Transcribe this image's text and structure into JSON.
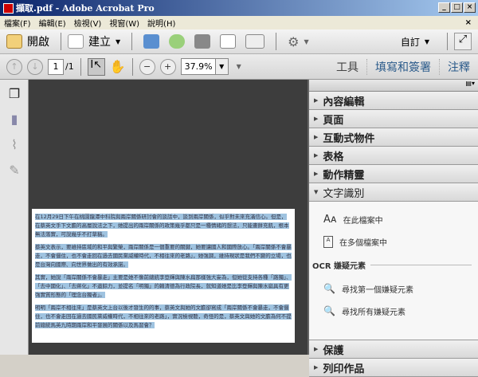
{
  "window": {
    "title": "擷取.pdf - Adobe Acrobat Pro",
    "min": "_",
    "max": "□",
    "close": "×"
  },
  "menu": [
    "檔案(F)",
    "編輯(E)",
    "檢視(V)",
    "視窗(W)",
    "說明(H)"
  ],
  "menu_close": "×",
  "toolbar": {
    "open": "開啟",
    "create": "建立",
    "customize": "自訂"
  },
  "nav": {
    "page": "1",
    "total": "/1",
    "zoom": "37.9%"
  },
  "pane_tabs": [
    "工具",
    "填寫和簽署",
    "注釋"
  ],
  "panel": {
    "sections_top": [
      "內容編輯",
      "頁面",
      "互動式物件",
      "表格",
      "動作精靈"
    ],
    "open_section": "文字識別",
    "items": [
      "在此檔案中",
      "在多個檔案中"
    ],
    "ocr_heading": "OCR 嫌疑元素",
    "ocr_items": [
      "尋找第一個嫌疑元素",
      "尋找所有嫌疑元素"
    ],
    "sections_bottom": [
      "保護",
      "列印作品"
    ]
  },
  "document": {
    "paragraphs": [
      "在12月29日下午在桃園龍潭中科院與兩岸關係研討會的談話中，談到兩岸關係，似乎對未來充滿信心。但是，在蔡英文手下文膽的高層說法之下，她提出的兩岸關係的政策幾乎都只是一種情緒的想法，只能畫餅充飢，根本無法落實，可說幾乎不打草稿。",
      "蔡英文表示，要維持區域的和平與繁榮，兩岸關係是一個重要的關鍵，她要讓國人和國際放心。「兩岸關係不會暴走，不會僵住，也不會走回在過去國民黨威權時代，不相往來的老路」，她強調，維持現狀是我們不變的立場，也是台灣向國際、向世界做出的有效承諾。",
      "其實，她說「兩岸關係不會暴走」主要是她不像前總統李登輝與陳水扁那樣強大妄為，但她從支持各種「路獨」、「去中國化」、「去蔣化」不遺餘力，並提名「明獨」的賴清德為行政院長，就知道她是比李登輝與陳水扁具有更強實質形態的「理念台獨者」。",
      "明明「兩岸不相往來」是蔡英文上台以後才發生的的事，蔡英文與她的文膽卻寫成「兩岸關係不會暴走，不會僵住，也不會走回在過去國民黨威權時代，不相往來的老路」，實況檢視聽，奇怪的是，蔡英文與她的文膽為何不提前總統馬英九時期兩岸和平發展的關係以及馬習會？"
    ]
  }
}
